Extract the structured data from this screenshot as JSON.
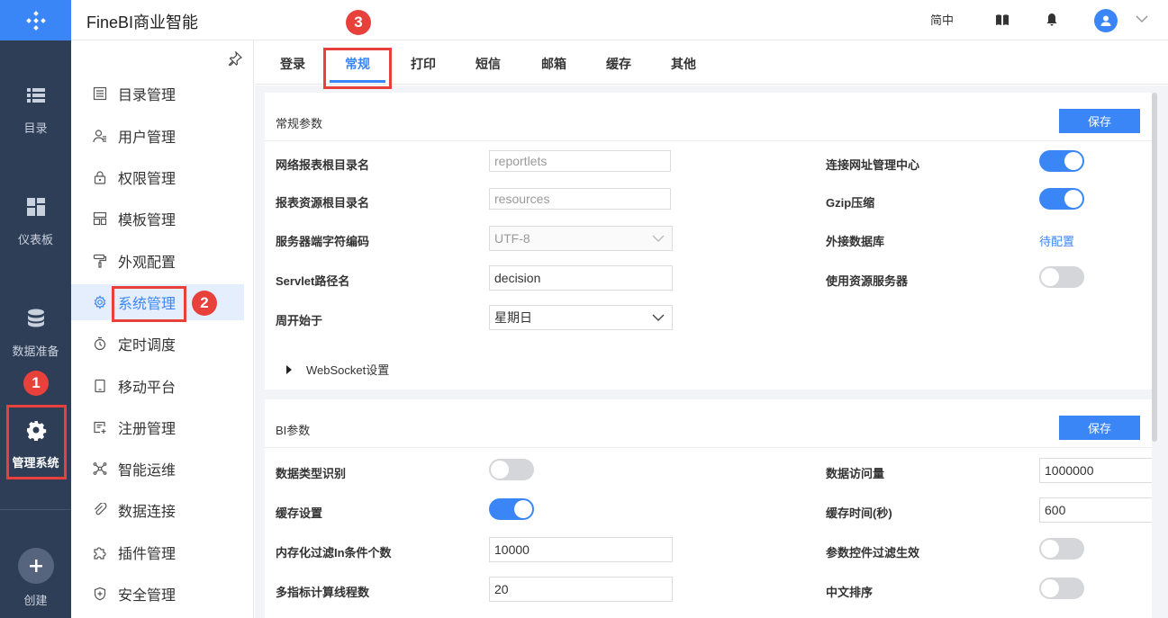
{
  "app": {
    "title": "FineBI商业智能"
  },
  "topbar": {
    "lang": "简中"
  },
  "rail": {
    "items": [
      {
        "label": "目录"
      },
      {
        "label": "仪表板"
      },
      {
        "label": "数据准备"
      },
      {
        "label": "管理系统"
      },
      {
        "label": "创建"
      }
    ]
  },
  "subnav": {
    "items": [
      {
        "label": "目录管理"
      },
      {
        "label": "用户管理"
      },
      {
        "label": "权限管理"
      },
      {
        "label": "模板管理"
      },
      {
        "label": "外观配置"
      },
      {
        "label": "系统管理"
      },
      {
        "label": "定时调度"
      },
      {
        "label": "移动平台"
      },
      {
        "label": "注册管理"
      },
      {
        "label": "智能运维"
      },
      {
        "label": "数据连接"
      },
      {
        "label": "插件管理"
      },
      {
        "label": "安全管理"
      }
    ],
    "active": "系统管理"
  },
  "tabs": [
    {
      "label": "登录"
    },
    {
      "label": "常规"
    },
    {
      "label": "打印"
    },
    {
      "label": "短信"
    },
    {
      "label": "邮箱"
    },
    {
      "label": "缓存"
    },
    {
      "label": "其他"
    }
  ],
  "general": {
    "title": "常规参数",
    "save": "保存",
    "report_root_label": "网络报表根目录名",
    "report_root_placeholder": "reportlets",
    "resource_root_label": "报表资源根目录名",
    "resource_root_placeholder": "resources",
    "encoding_label": "服务器端字符编码",
    "encoding_value": "UTF-8",
    "servlet_label": "Servlet路径名",
    "servlet_value": "decision",
    "week_start_label": "周开始于",
    "week_start_value": "星期日",
    "websocket_label": "WebSocket设置",
    "url_center_label": "连接网址管理中心",
    "url_center_on": true,
    "gzip_label": "Gzip压缩",
    "gzip_on": true,
    "ext_db_label": "外接数据库",
    "ext_db_value": "待配置",
    "resource_server_label": "使用资源服务器",
    "resource_server_on": false
  },
  "bi": {
    "title": "BI参数",
    "save": "保存",
    "type_detect_label": "数据类型识别",
    "type_detect_on": false,
    "cache_label": "缓存设置",
    "cache_on": true,
    "in_filter_label": "内存化过滤In条件个数",
    "in_filter_value": "10000",
    "threads_label": "多指标计算线程数",
    "threads_value": "20",
    "access_label": "数据访问量",
    "access_value": "1000000",
    "cache_time_label": "缓存时间(秒)",
    "cache_time_value": "600",
    "param_filter_label": "参数控件过滤生效",
    "param_filter_on": false,
    "cn_sort_label": "中文排序",
    "cn_sort_on": false
  },
  "annotations": {
    "badge1": "1",
    "badge2": "2",
    "badge3": "3"
  },
  "colors": {
    "accent": "#3b86f7",
    "rail": "#2e3e57",
    "mark": "#e8413c"
  }
}
